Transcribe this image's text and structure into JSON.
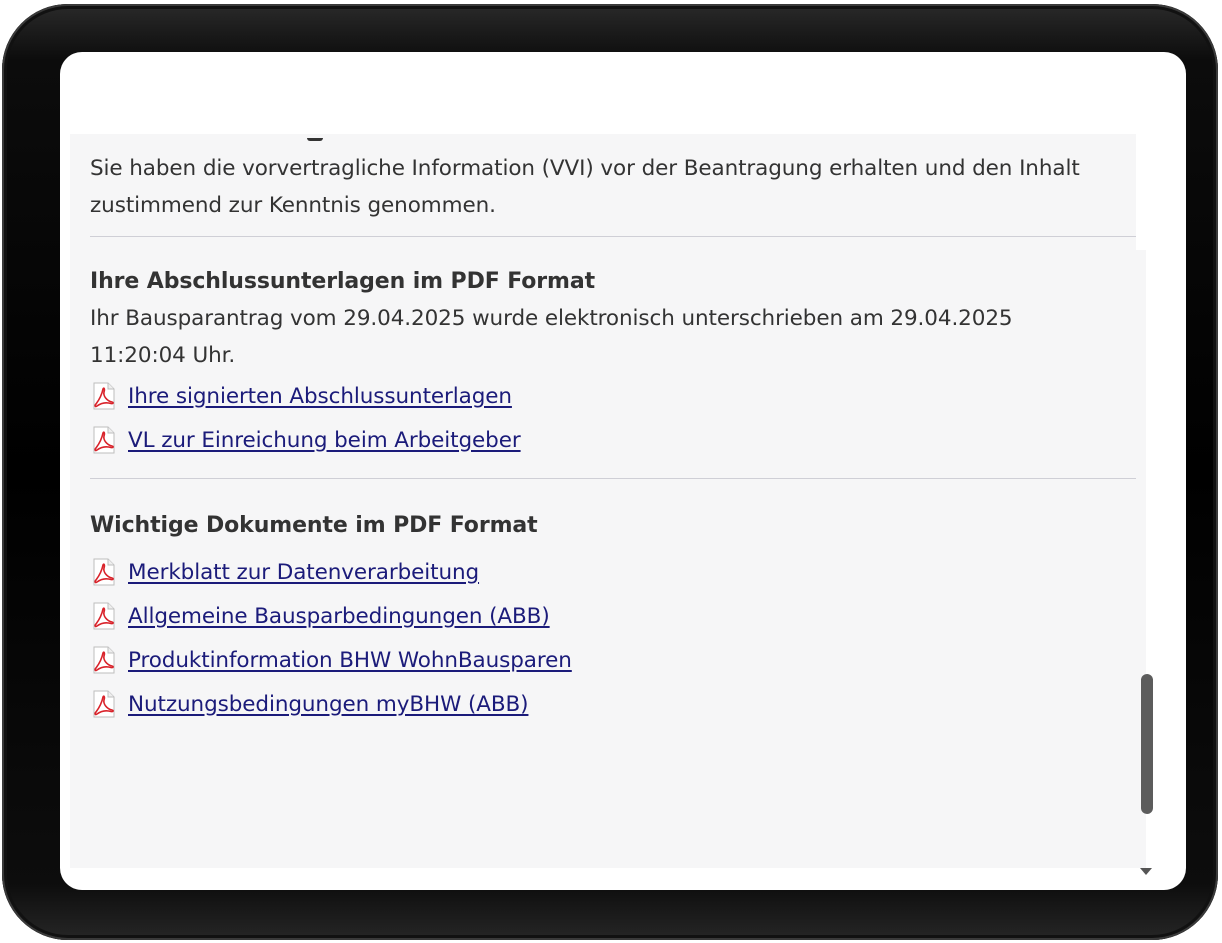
{
  "vvi_notice": "Sie haben die vorvertragliche Information (VVI) vor der Beantragung erhalten und den Inhalt zustimmend zur Kenntnis genommen.",
  "closing_documents": {
    "title": "Ihre Abschlussunterlagen im PDF Format",
    "signed_text_line1": "Ihr Bausparantrag vom 29.04.2025 wurde elektronisch unterschrieben am 29.04.2025",
    "signed_text_line2": "11:20:04 Uhr.",
    "links": [
      {
        "label": "Ihre signierten Abschlussunterlagen",
        "icon": "pdf-icon"
      },
      {
        "label": "VL zur Einreichung beim Arbeitgeber",
        "icon": "pdf-icon"
      }
    ]
  },
  "important_documents": {
    "title": "Wichtige Dokumente im PDF Format",
    "links": [
      {
        "label": "Merkblatt zur Datenverarbeitung",
        "icon": "pdf-icon"
      },
      {
        "label": "Allgemeine Bausparbedingungen (ABB)",
        "icon": "pdf-icon"
      },
      {
        "label": "Produktinformation BHW WohnBausparen",
        "icon": "pdf-icon"
      },
      {
        "label": "Nutzungsbedingungen myBHW (ABB)",
        "icon": "pdf-icon"
      }
    ]
  },
  "colors": {
    "link": "#1b1b7a",
    "pdf_icon": "#d9222a",
    "panel_background": "#f6f6f7",
    "device_frame": "#000000"
  }
}
